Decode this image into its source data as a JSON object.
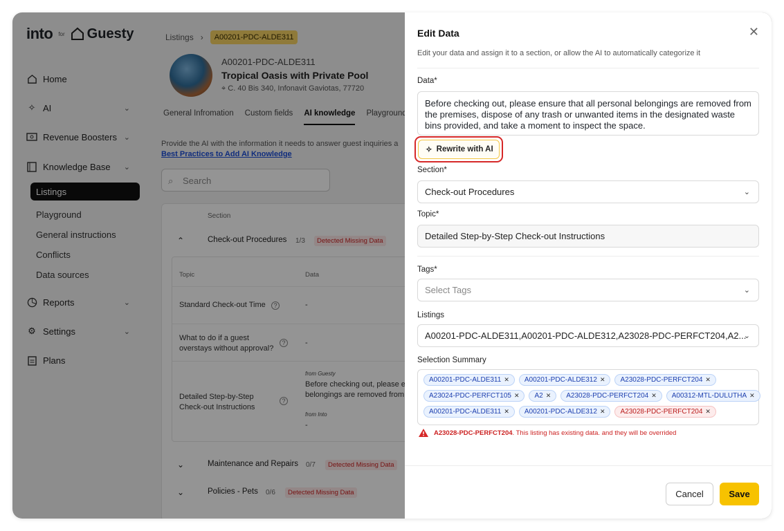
{
  "brand": {
    "name_prefix": "into",
    "name_for": "for",
    "name_partner": "Guesty"
  },
  "sidebar": {
    "home": "Home",
    "ai": "AI",
    "revenue_boosters": "Revenue Boosters",
    "knowledge_base": "Knowledge Base",
    "kb_items": [
      "Listings",
      "Playground",
      "General instructions",
      "Conflicts",
      "Data sources"
    ],
    "reports": "Reports",
    "settings": "Settings",
    "plans": "Plans"
  },
  "main": {
    "breadcrumb_root": "Listings",
    "breadcrumb_current": "A00201-PDC-ALDE311",
    "listing_code": "A00201-PDC-ALDE311",
    "listing_name": "Tropical Oasis with Private Pool",
    "listing_address": "C. 40 Bis 340, Infonavit Gaviotas, 77720",
    "tabs": [
      "General Infromation",
      "Custom fields",
      "AI knowledge",
      "Playground"
    ],
    "hint": "Provide the AI with the information it needs to answer guest inquiries a",
    "hint_link": "Best Practices to Add AI Knowledge",
    "search_placeholder": "Search",
    "table": {
      "col_section": "Section",
      "groups": [
        {
          "name": "Check-out Procedures",
          "count": "1/3",
          "badge": "Detected Missing Data"
        },
        {
          "name": "Maintenance and Repairs",
          "count": "0/7",
          "badge": "Detected Missing Data"
        },
        {
          "name": "Policies - Pets",
          "count": "0/6",
          "badge": "Detected Missing Data"
        }
      ],
      "sub_col_topic": "Topic",
      "sub_col_data": "Data",
      "rows": [
        {
          "topic": "Standard Check-out Time",
          "data": "-"
        },
        {
          "topic": "What to do if a guest overstays without approval?",
          "data": "-"
        },
        {
          "topic": "Detailed Step-by-Step Check-out Instructions",
          "from_guesty": "from Guesty",
          "data": "Before checking out, please e belongings are removed from",
          "from_into": "from Into",
          "data2": "-"
        }
      ]
    }
  },
  "modal": {
    "title": "Edit Data",
    "subtitle": "Edit your data and assign it to a section, or allow the AI to automatically categorize it",
    "data_label": "Data*",
    "data_value": "Before checking out, please ensure that all personal belongings are removed from the premises, dispose of any trash or unwanted items in the designated waste bins provided, and take a moment to inspect the space.",
    "rewrite_label": "Rewrite with AI",
    "section_label": "Section*",
    "section_value": "Check-out Procedures",
    "topic_label": "Topic*",
    "topic_value": "Detailed Step-by-Step Check-out Instructions",
    "tags_label": "Tags*",
    "tags_placeholder": "Select Tags",
    "listings_label": "Listings",
    "listings_value": "A00201-PDC-ALDE311,A00201-PDC-ALDE312,A23028-PDC-PERFCT204,A2...",
    "summary_label": "Selection Summary",
    "chips": [
      [
        "A00201-PDC-ALDE311",
        "A00201-PDC-ALDE312",
        "A23028-PDC-PERFCT204"
      ],
      [
        "A23024-PDC-PERFCT105",
        "A2",
        "A23028-PDC-PERFCT204",
        "A00312-MTL-DULUTHA"
      ],
      [
        "A00201-PDC-ALDE311",
        "A00201-PDC-ALDE312",
        "A23028-PDC-PERFCT204"
      ]
    ],
    "warning_code": "A23028-PDC-PERFCT204",
    "warning_text": ". This listing has existing data. and they will be overrided",
    "cancel": "Cancel",
    "save": "Save"
  },
  "colors": {
    "accent": "#f7c200",
    "error": "#d62828",
    "link": "#1d4ed8",
    "chip_bg": "#eaf2fe"
  }
}
